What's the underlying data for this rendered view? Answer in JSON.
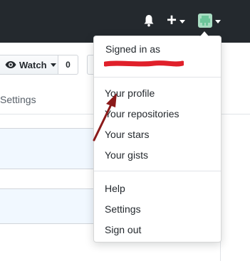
{
  "header": {
    "icons": [
      "bell-icon",
      "plus-icon",
      "avatar"
    ]
  },
  "repo_toolbar": {
    "watch_label": "Watch",
    "watch_count": "0",
    "settings_tab": "Settings"
  },
  "dropdown": {
    "signed_in_label": "Signed in as",
    "items": [
      "Your profile",
      "Your repositories",
      "Your stars",
      "Your gists"
    ],
    "secondary_items": [
      "Help",
      "Settings",
      "Sign out"
    ]
  },
  "annotation": {
    "arrow_color": "#8b1a1a",
    "redaction_color": "#e0202a"
  }
}
